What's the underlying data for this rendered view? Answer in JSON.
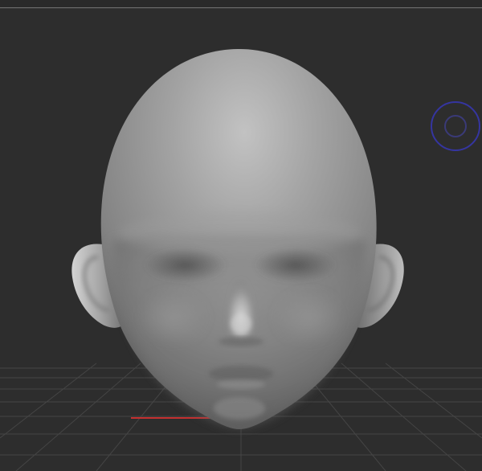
{
  "viewport": {
    "label": "",
    "background_color": "#2d2d2d",
    "grid_color": "#4a4a4a",
    "x_axis_color": "#c43030",
    "gizmo_color": "#3535a0"
  },
  "model": {
    "icon": "head-sculpt-icon",
    "skin_light": "#bdbdbd",
    "skin_mid": "#8e8e8e",
    "skin_dark": "#5a5a5a"
  },
  "gizmo": {
    "icon": "rotation-gizmo-icon"
  }
}
